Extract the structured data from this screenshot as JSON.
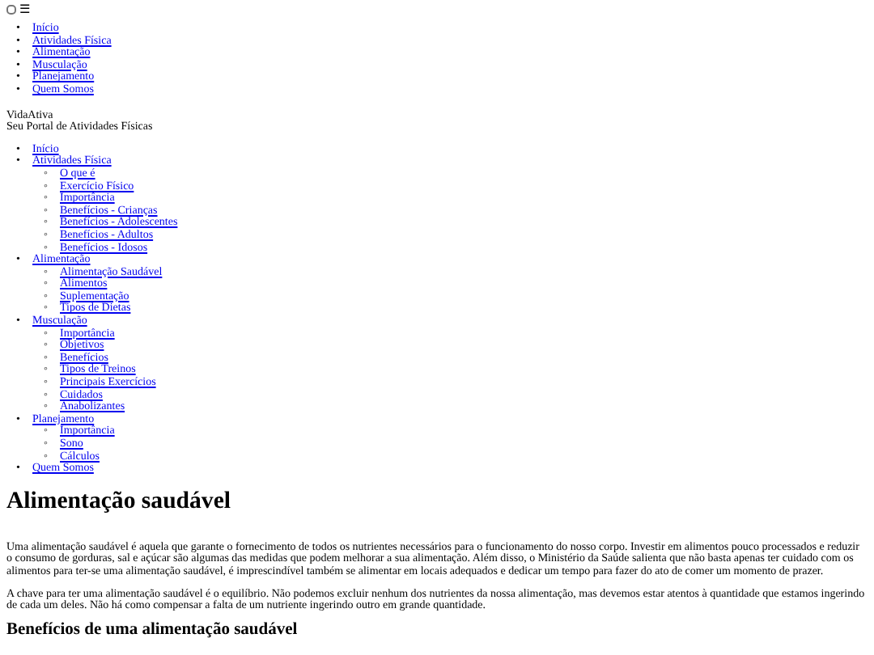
{
  "menu_toggle": {
    "checked": false,
    "icon": "☰"
  },
  "markers": {
    "bullet": "•",
    "sub_bullet": "◦"
  },
  "top_nav": [
    "Início",
    "Atividades Física",
    "Alimentação",
    "Musculação",
    "Planejamento",
    "Quem Somos"
  ],
  "brand": {
    "name": "VidaAtiva",
    "tagline": "Seu Portal de Atividades Físicas"
  },
  "main_nav": [
    {
      "label": "Início"
    },
    {
      "label": "Atividades Física",
      "children": [
        "O que é",
        "Exercício Físico",
        "Importância",
        "Benefícios - Crianças",
        "Benefícios - Adolescentes",
        "Benefícios - Adultos",
        "Benefícios - Idosos"
      ]
    },
    {
      "label": "Alimentação",
      "children": [
        "Alimentação Saudável",
        "Alimentos",
        "Suplementação",
        "Tipos de Dietas"
      ]
    },
    {
      "label": "Musculação",
      "children": [
        "Importância",
        "Objetivos",
        "Benefícios",
        "Tipos de Treinos",
        "Principais Exercícios",
        "Cuidados",
        "Anabolizantes"
      ]
    },
    {
      "label": "Planejamento",
      "children": [
        "Importância",
        "Sono",
        "Cálculos"
      ]
    },
    {
      "label": "Quem Somos"
    }
  ],
  "article": {
    "title": "Alimentação saudável",
    "paragraphs": [
      "Uma alimentação saudável é aquela que garante o fornecimento de todos os nutrientes necessários para o funcionamento do nosso corpo. Investir em alimentos pouco processados e reduzir o consumo de gorduras, sal e açúcar são algumas das medidas que podem melhorar a sua alimentação. Além disso, o Ministério da Saúde salienta que não basta apenas ter cuidado com os alimentos para ter-se uma alimentação saudável, é imprescindível também se alimentar em locais adequados e dedicar um tempo para fazer do ato de comer um momento de prazer.",
      "A chave para ter uma alimentação saudável é o equilíbrio. Não podemos excluir nenhum dos nutrientes da nossa alimentação, mas devemos estar atentos à quantidade que estamos ingerindo de cada um deles. Não há como compensar a falta de um nutriente ingerindo outro em grande quantidade."
    ],
    "subheading": "Benefícios de uma alimentação saudável"
  }
}
